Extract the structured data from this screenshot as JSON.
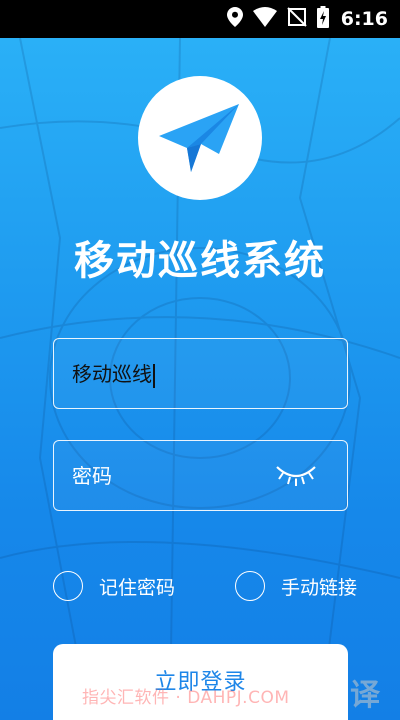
{
  "status_bar": {
    "time": "6:16",
    "icons": [
      "location-icon",
      "wifi-icon",
      "no-sim-icon",
      "battery-charging-icon"
    ]
  },
  "app": {
    "logo_icon": "paper-plane-icon",
    "title": "移动巡线系统"
  },
  "form": {
    "username_value": "移动巡线",
    "password_placeholder": "密码",
    "password_toggle_icon": "eye-closed-icon",
    "remember_label": "记住密码",
    "manual_link_label": "手动链接",
    "login_label": "立即登录"
  },
  "watermark": {
    "text": "指尖汇软件 · DAHPJ.COM",
    "corner": "译"
  },
  "colors": {
    "background_top": "#2ab0f7",
    "background_bottom": "#137fe6",
    "accent": "#1d86e8",
    "logo_plane": "#2aa3f5"
  }
}
